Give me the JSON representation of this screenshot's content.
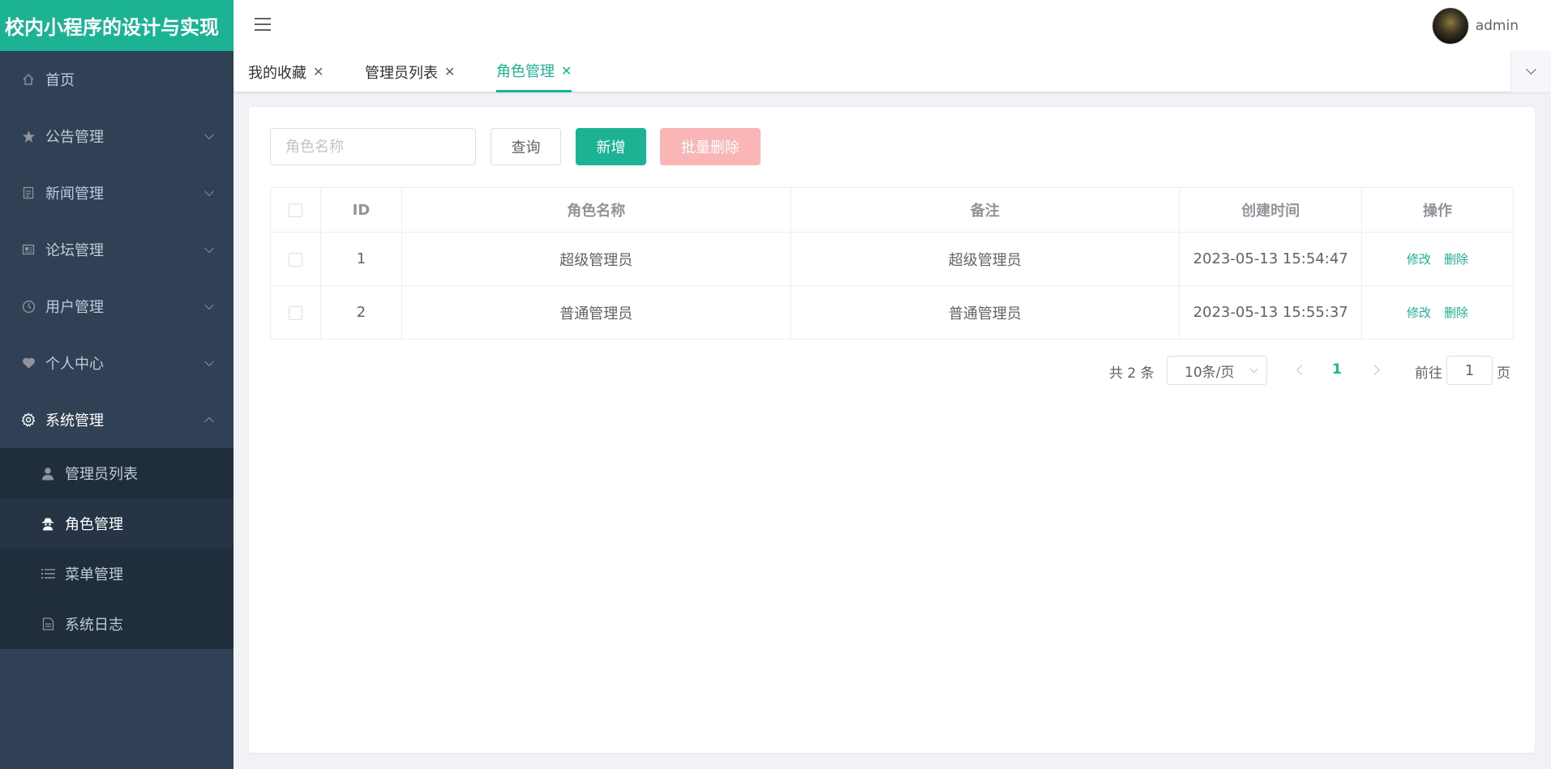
{
  "app": {
    "title": "校内小程序的设计与实现"
  },
  "sidebar": {
    "items": [
      {
        "label": "首页",
        "icon": "home-icon"
      },
      {
        "label": "公告管理",
        "icon": "star-icon"
      },
      {
        "label": "新闻管理",
        "icon": "document-icon"
      },
      {
        "label": "论坛管理",
        "icon": "picture-icon"
      },
      {
        "label": "用户管理",
        "icon": "clock-icon"
      },
      {
        "label": "个人中心",
        "icon": "heart-icon"
      },
      {
        "label": "系统管理",
        "icon": "gear-icon"
      }
    ],
    "submenu": [
      {
        "label": "管理员列表",
        "icon": "user-icon"
      },
      {
        "label": "角色管理",
        "icon": "spy-icon"
      },
      {
        "label": "菜单管理",
        "icon": "list-icon"
      },
      {
        "label": "系统日志",
        "icon": "log-icon"
      }
    ]
  },
  "header": {
    "username": "admin"
  },
  "tabs": [
    {
      "label": "我的收藏"
    },
    {
      "label": "管理员列表"
    },
    {
      "label": "角色管理"
    }
  ],
  "search": {
    "placeholder": "角色名称"
  },
  "toolbar": {
    "query_label": "查询",
    "add_label": "新增",
    "batch_delete_label": "批量删除"
  },
  "table": {
    "headers": [
      "ID",
      "角色名称",
      "备注",
      "创建时间",
      "操作"
    ],
    "rows": [
      {
        "id": "1",
        "name": "超级管理员",
        "remark": "超级管理员",
        "created": "2023-05-13 15:54:47"
      },
      {
        "id": "2",
        "name": "普通管理员",
        "remark": "普通管理员",
        "created": "2023-05-13 15:55:37"
      }
    ],
    "edit_label": "修改",
    "delete_label": "删除"
  },
  "pagination": {
    "total": "共 2 条",
    "page_size": "10条/页",
    "current_page": "1",
    "goto_label": "前往",
    "goto_value": "1",
    "page_suffix": "页"
  },
  "colors": {
    "accent": "#1bb394",
    "sidebar_bg": "#304156",
    "danger_light": "#fab6b6"
  }
}
